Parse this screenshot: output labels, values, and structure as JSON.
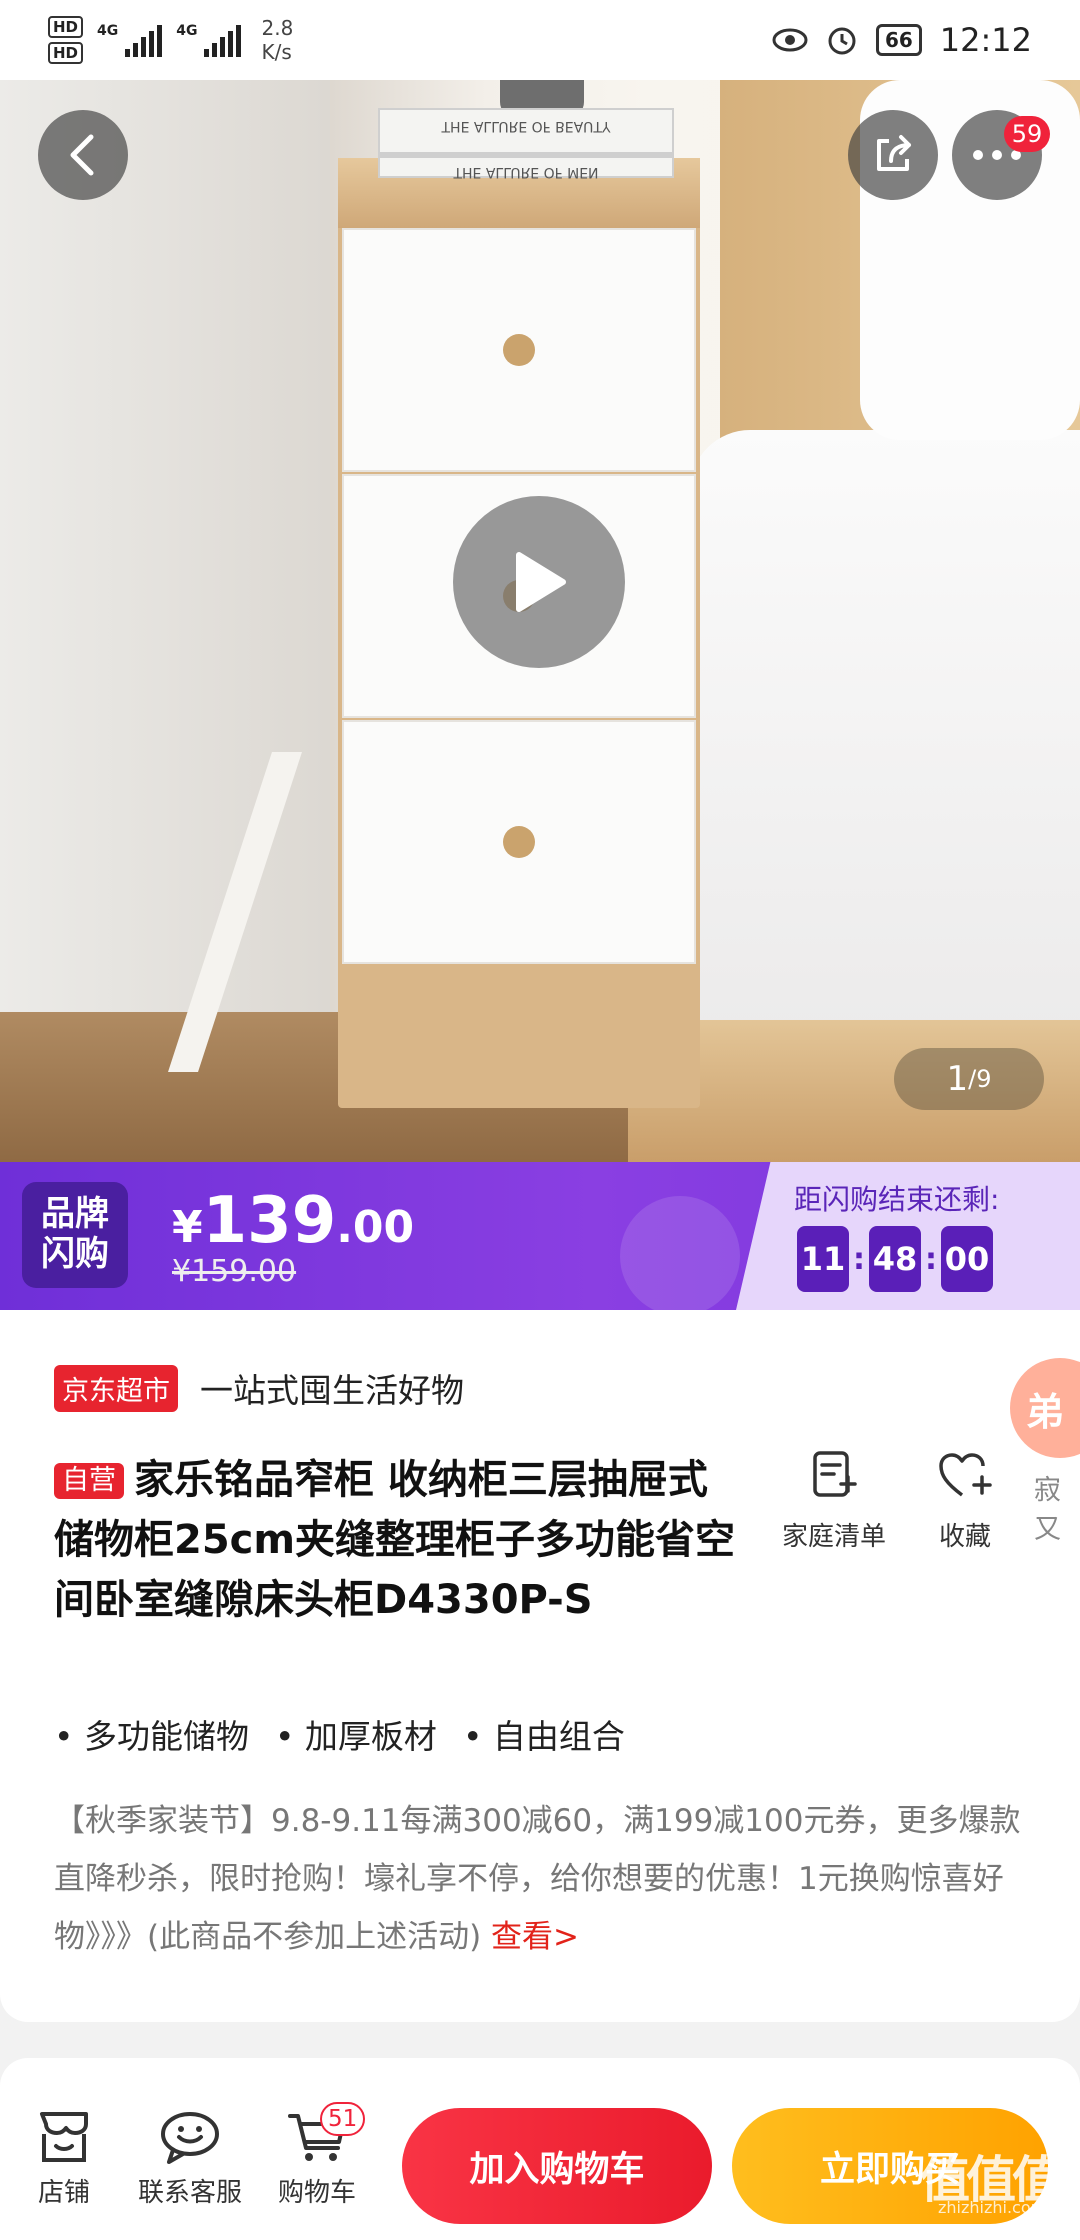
{
  "status_bar": {
    "hd1": "HD",
    "hd2": "HD",
    "sig1": "4G",
    "sig2": "4G",
    "speed_value": "2.8",
    "speed_unit": "K/s",
    "battery": "66",
    "time": "12:12"
  },
  "hero": {
    "more_badge": "59",
    "image_index": "1",
    "image_total": "/9",
    "book_text_1": "THE ALLURE OF BEAUTY",
    "book_text_2": "THE ALLURE OF MEN"
  },
  "flash_sale": {
    "tag_line1": "品牌",
    "tag_line2": "闪购",
    "currency": "¥",
    "price_int": "139",
    "price_dec": ".00",
    "original_price": "¥159.00",
    "countdown_label": "距闪购结束还剩:",
    "hours": "11",
    "minutes": "48",
    "seconds": "00"
  },
  "product": {
    "store_tag": "京东超市",
    "store_slogan": "一站式囤生活好物",
    "side_promo": "弟",
    "side_caption": "寂又",
    "self_tag": "自营",
    "title": "家乐铭品窄柜 收纳柜三层抽屉式储物柜25cm夹缝整理柜子多功能省空间卧室缝隙床头柜D4330P-S",
    "action_list": "家庭清单",
    "action_fav": "收藏",
    "features": [
      "• 多功能储物",
      "• 加厚板材",
      "• 自由组合"
    ],
    "promo_text": "【秋季家装节】9.8-9.11每满300减60，满199减100元券，更多爆款直降秒杀，限时抢购！壕礼享不停，给你想要的优惠！1元换购惊喜好物》》》(此商品不参加上述活动)",
    "promo_link": "查看>"
  },
  "bottom_bar": {
    "store": "店铺",
    "service": "联系客服",
    "cart": "购物车",
    "cart_badge": "51",
    "add_to_cart": "加入购物车",
    "buy_now": "立即购买",
    "watermark": "值值值",
    "watermark_url": "zhizhizhi.com"
  },
  "colors": {
    "brand_red": "#e7242f",
    "flash_purple": "#7a35dd",
    "buy_orange": "#ffa200"
  }
}
